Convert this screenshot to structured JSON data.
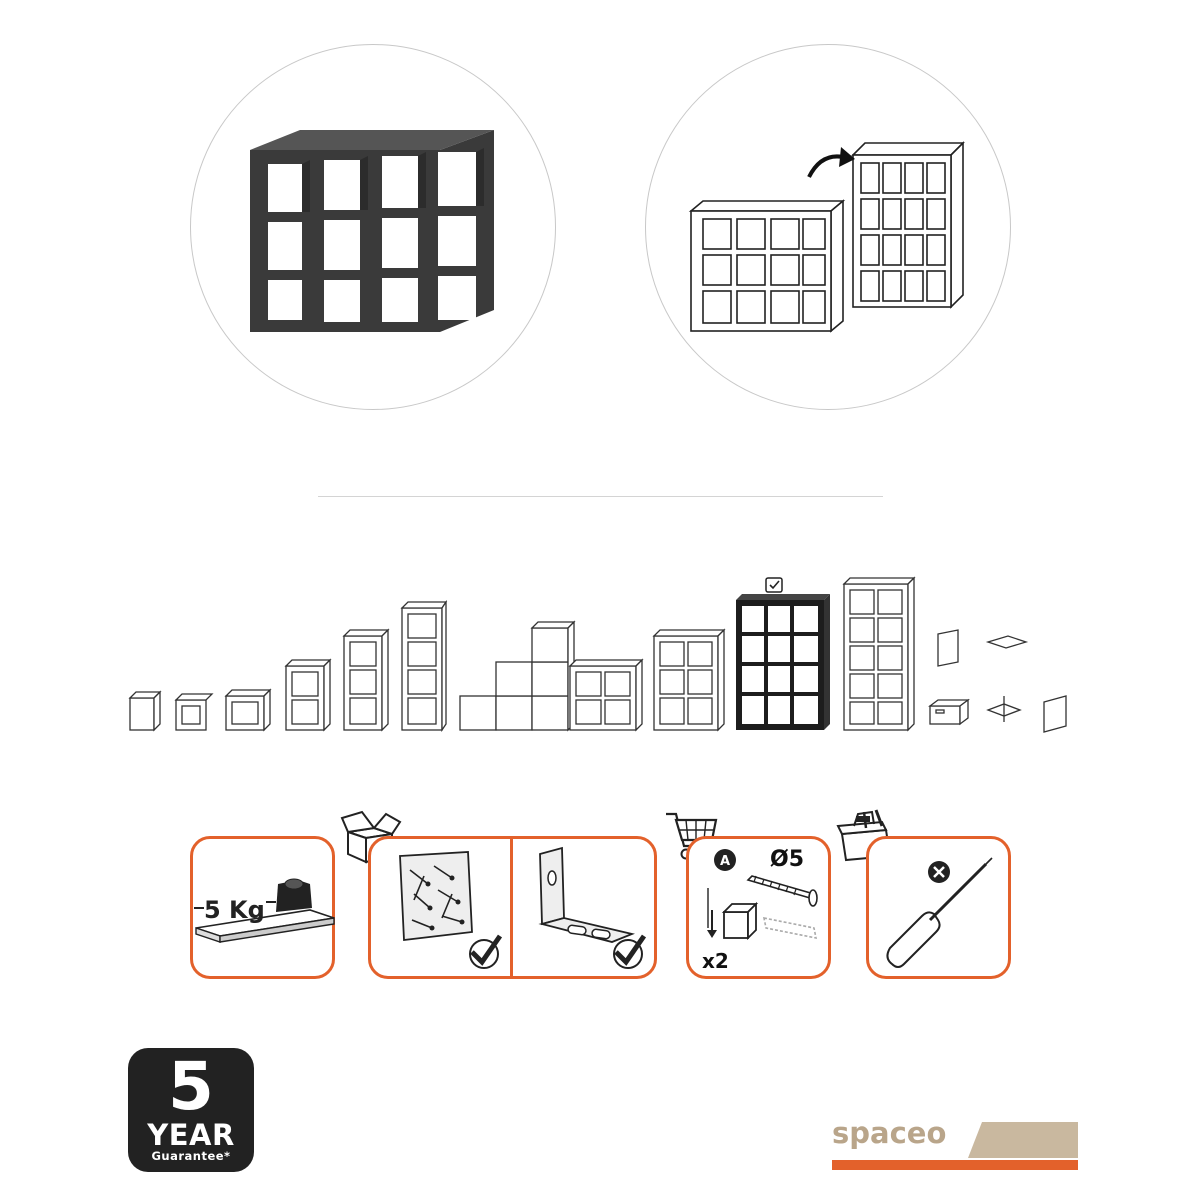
{
  "weight_label": "5 Kg",
  "fixing": {
    "marker": "A",
    "diameter": "Ø5",
    "quantity": "x2"
  },
  "guarantee": {
    "years": "5",
    "unit": "YEAR",
    "text": "Guarantee*"
  },
  "brand": {
    "name": "spaceo",
    "accent_color": "#e3612b",
    "tan_color": "#c9b89f"
  },
  "panel_border_color": "#e3612b",
  "range_selected_index": 10,
  "icons": [
    "shelf-unit-black",
    "shelf-rotate",
    "box-icon",
    "screws-bag",
    "angle-bracket",
    "cart-icon",
    "screw-icon",
    "plug-icon",
    "toolbox-icon",
    "screwdriver-icon",
    "check-icon",
    "cross-icon"
  ]
}
